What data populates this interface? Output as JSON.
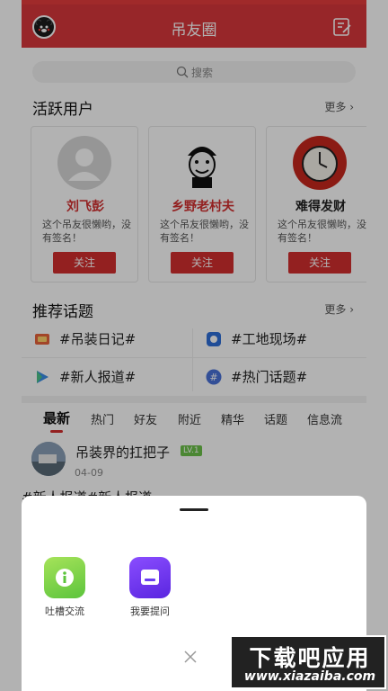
{
  "header": {
    "title": "吊友圈"
  },
  "search": {
    "placeholder": "搜索"
  },
  "active_users": {
    "title": "活跃用户",
    "more": "更多",
    "users": [
      {
        "name": "刘飞彭",
        "bio": "这个吊友很懒哟，没有签名！",
        "follow": "关注"
      },
      {
        "name": "乡野老村夫",
        "bio": "这个吊友很懒哟，没有签名！",
        "follow": "关注"
      },
      {
        "name": "难得发财",
        "bio": "这个吊友很懒哟，没有签名！",
        "follow": "关注"
      }
    ]
  },
  "topics": {
    "title": "推荐话题",
    "more": "更多",
    "items": [
      {
        "label": "#吊装日记#"
      },
      {
        "label": "#工地现场#"
      },
      {
        "label": "#新人报道#"
      },
      {
        "label": "#热门话题#"
      }
    ]
  },
  "tabs": [
    "最新",
    "热门",
    "好友",
    "附近",
    "精华",
    "话题",
    "信息流"
  ],
  "post": {
    "author": "吊装界的扛把子",
    "level": "LV.1",
    "date": "04-09",
    "preview": "#新人报道#新人报道"
  },
  "sheet": {
    "actions": [
      {
        "label": "吐槽交流",
        "color": "#7cd44e"
      },
      {
        "label": "我要提问",
        "color": "#6a3df0"
      }
    ]
  },
  "watermark": {
    "line1": "下载吧应用",
    "line2": "www.xiazaiba.com"
  }
}
